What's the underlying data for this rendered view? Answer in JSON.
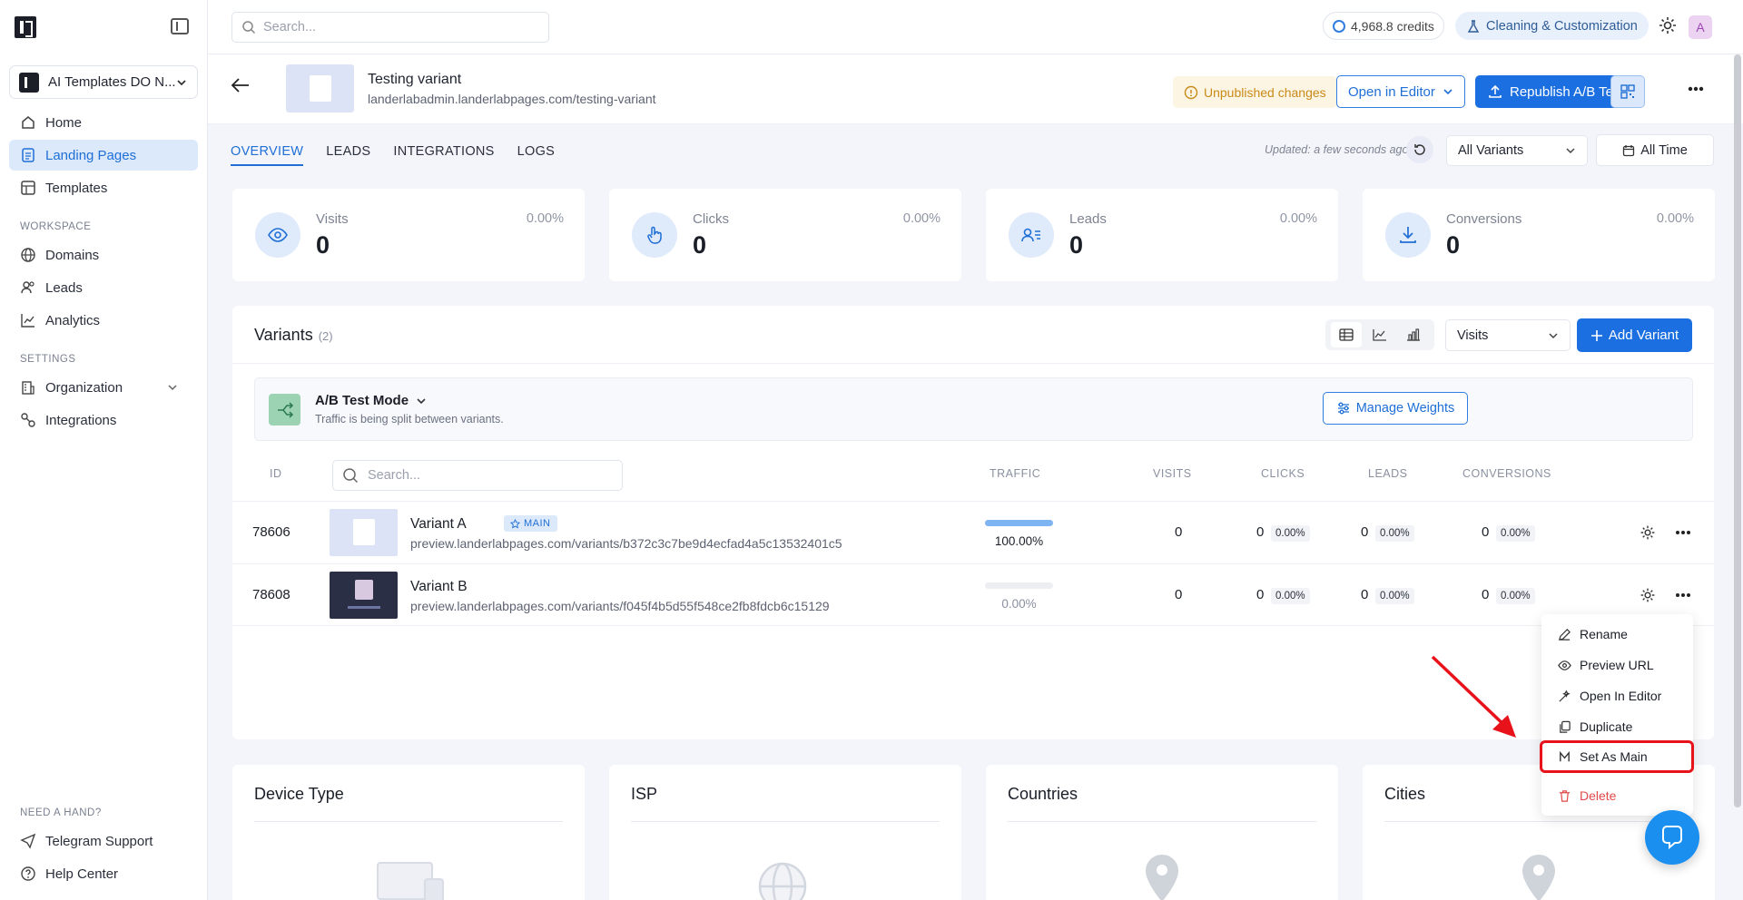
{
  "sidebar": {
    "workspace": "AI Templates DO N...",
    "items": [
      {
        "label": "Home"
      },
      {
        "label": "Landing Pages"
      },
      {
        "label": "Templates"
      },
      {
        "label": "Domains"
      },
      {
        "label": "Leads"
      },
      {
        "label": "Analytics"
      },
      {
        "label": "Organization"
      },
      {
        "label": "Integrations"
      },
      {
        "label": "Telegram Support"
      },
      {
        "label": "Help Center"
      }
    ],
    "sections": {
      "workspace": "WORKSPACE",
      "settings": "SETTINGS",
      "help": "NEED A HAND?"
    }
  },
  "topbar": {
    "search_placeholder": "Search...",
    "credits": "4,968.8 credits",
    "customization": "Cleaning & Customization",
    "avatar": "A"
  },
  "page": {
    "title": "Testing variant",
    "url": "landerlabadmin.landerlabpages.com/testing-variant",
    "unpublished": "Unpublished changes",
    "open_editor": "Open in Editor",
    "republish": "Republish A/B Test"
  },
  "tabs": [
    "OVERVIEW",
    "LEADS",
    "INTEGRATIONS",
    "LOGS"
  ],
  "filters": {
    "updated": "Updated: a few seconds ago",
    "variant_select": "All Variants",
    "time": "All Time"
  },
  "stats": [
    {
      "label": "Visits",
      "value": "0",
      "pct": "0.00%"
    },
    {
      "label": "Clicks",
      "value": "0",
      "pct": "0.00%"
    },
    {
      "label": "Leads",
      "value": "0",
      "pct": "0.00%"
    },
    {
      "label": "Conversions",
      "value": "0",
      "pct": "0.00%"
    }
  ],
  "variants": {
    "title": "Variants",
    "count": "(2)",
    "metric": "Visits",
    "add": "Add Variant",
    "mode_title": "A/B Test Mode",
    "mode_sub": "Traffic is being split between variants.",
    "manage": "Manage Weights",
    "search_placeholder": "Search...",
    "headers": {
      "id": "ID",
      "traffic": "TRAFFIC",
      "visits": "VISITS",
      "clicks": "CLICKS",
      "leads": "LEADS",
      "conversions": "CONVERSIONS"
    },
    "main_badge": "MAIN",
    "rows": [
      {
        "id": "78606",
        "name": "Variant A",
        "url": "preview.landerlabpages.com/variants/b372c3c7be9d4ecfad4a5c13532401c5",
        "traffic": "100.00%",
        "traffic_fraction": 1.0,
        "visits": "0",
        "clicks": "0",
        "clicks_pct": "0.00%",
        "leads": "0",
        "leads_pct": "0.00%",
        "conv": "0",
        "conv_pct": "0.00%"
      },
      {
        "id": "78608",
        "name": "Variant B",
        "url": "preview.landerlabpages.com/variants/f045f4b5d55f548ce2fb8fdcb6c15129",
        "traffic": "0.00%",
        "traffic_fraction": 0.0,
        "visits": "0",
        "clicks": "0",
        "clicks_pct": "0.00%",
        "leads": "0",
        "leads_pct": "0.00%",
        "conv": "0",
        "conv_pct": "0.00%"
      }
    ]
  },
  "menu": [
    "Rename",
    "Preview URL",
    "Open In Editor",
    "Duplicate",
    "Set As Main",
    "Delete"
  ],
  "bottom_cards": [
    "Device Type",
    "ISP",
    "Countries",
    "Cities"
  ],
  "colors": {
    "accent": "#1c6fe0",
    "highlight": "#e8121b",
    "warning": "#c98a18",
    "danger": "#e24a4a"
  }
}
